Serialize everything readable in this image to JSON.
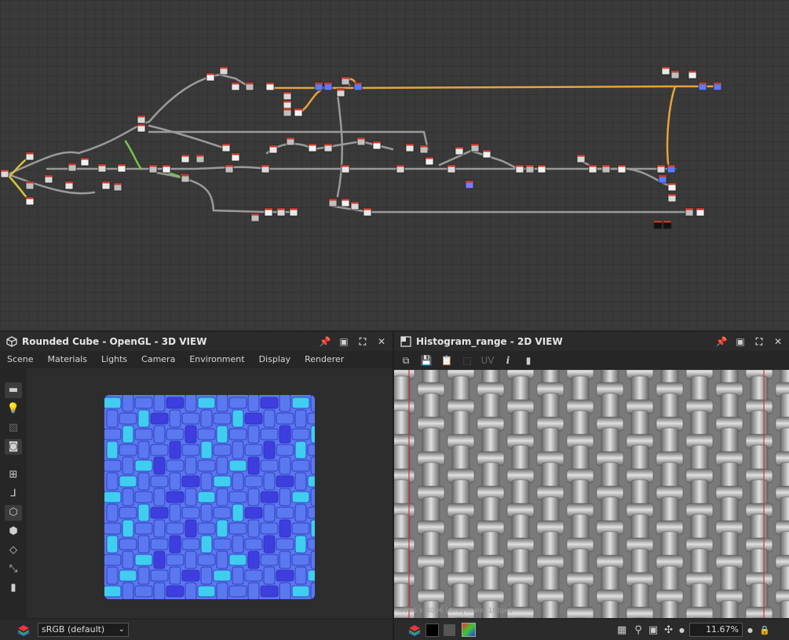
{
  "app": {
    "accent": "#e8a33a"
  },
  "graph": {
    "name": "node-graph"
  },
  "panel3d": {
    "title": "Rounded Cube - OpenGL - 3D VIEW",
    "icon": "cube-icon",
    "menu": [
      "Scene",
      "Materials",
      "Lights",
      "Camera",
      "Environment",
      "Display",
      "Renderer"
    ],
    "colorspace": "sRGB (default)",
    "pattern": {
      "dark": "#3d3be0",
      "mid": "#5a78f0",
      "light": "#3fd2f0"
    }
  },
  "panel2d": {
    "title": "Histogram_range - 2D VIEW",
    "uv_label": "UV",
    "info_label": "i",
    "resolution": "4096 x 4096 (Grayscale, 16bpc)",
    "zoom": "11.67%",
    "pattern": {
      "base": "#9e9e9e",
      "hi": "#e0e0e0",
      "lo": "#6a6a6a"
    },
    "guide_color": "#d03030"
  }
}
